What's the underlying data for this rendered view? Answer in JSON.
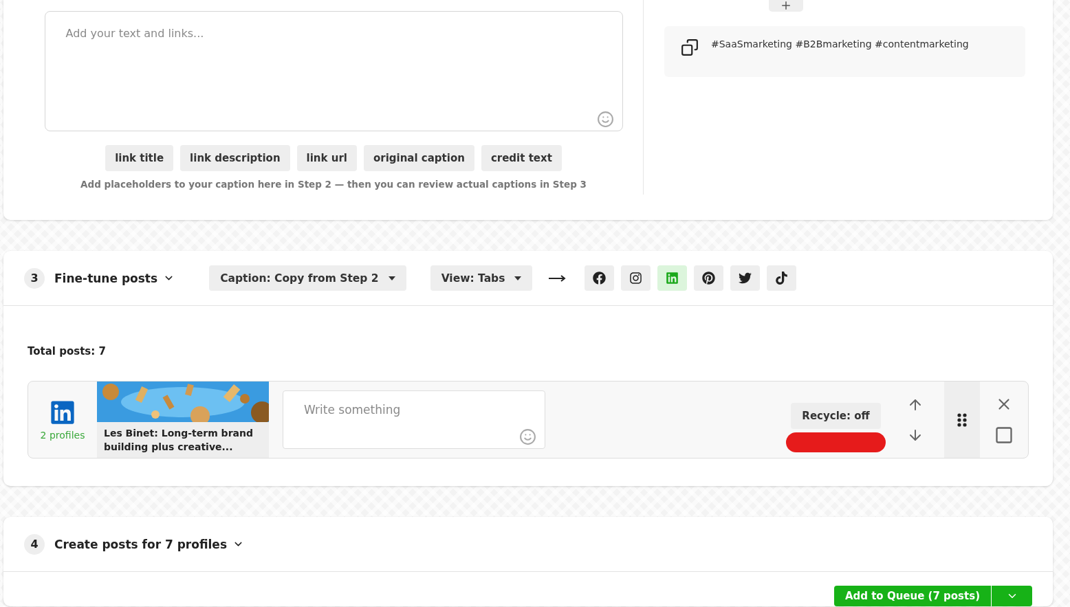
{
  "step2": {
    "caption": {
      "placeholder": "Add your text and links..."
    },
    "placeholders": [
      "link title",
      "link description",
      "link url",
      "original caption",
      "credit text"
    ],
    "hint": "Add placeholders to your caption here in Step 2 — then you can review actual captions in Step 3",
    "saved_texts": [
      "#SaaSmarketing #B2Bmarketing #contentmarketing"
    ]
  },
  "step3": {
    "number": "3",
    "title": "Fine-tune posts",
    "caption_dropdown": "Caption: Copy from Step 2",
    "view_dropdown": "View: Tabs",
    "networks": [
      {
        "kind": "facebook",
        "selected": false
      },
      {
        "kind": "instagram",
        "selected": false
      },
      {
        "kind": "linkedin",
        "selected": true
      },
      {
        "kind": "pinterest",
        "selected": false
      },
      {
        "kind": "twitter",
        "selected": false
      },
      {
        "kind": "tiktok",
        "selected": false
      }
    ],
    "total_posts": "Total posts: 7",
    "posts": [
      {
        "kind": "linkedin",
        "checked": false,
        "profiles": "2 profiles",
        "link_title": "Les Binet: Long-term brand building plus creative...",
        "placeholder": "Write something",
        "recycle": "Recycle: off"
      }
    ]
  },
  "step4": {
    "number": "4",
    "title": "Create posts for 7 profiles",
    "primary_button": "Add to Queue (7 posts)"
  }
}
